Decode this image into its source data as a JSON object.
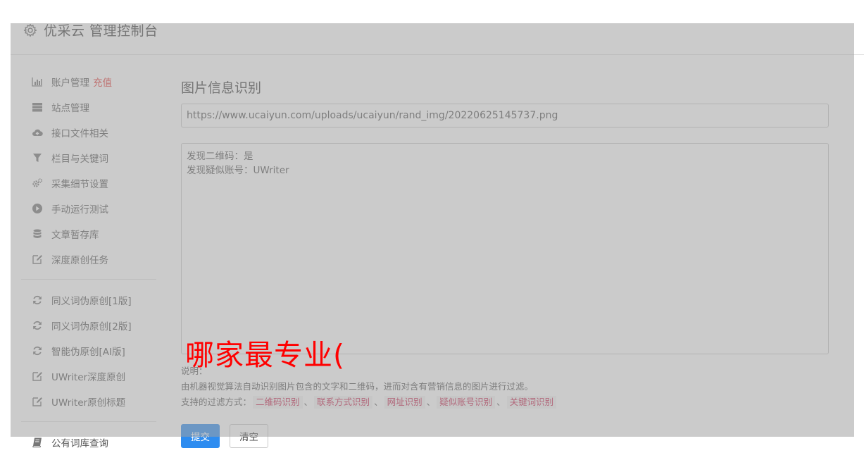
{
  "header": {
    "title": "优采云 管理控制台",
    "icon": "gear-icon"
  },
  "sidebar": {
    "group1": [
      {
        "label": "账户管理",
        "badge": "充值",
        "icon": "bar-chart-icon"
      },
      {
        "label": "站点管理",
        "icon": "server-icon"
      },
      {
        "label": "接口文件相关",
        "icon": "cloud-upload-icon"
      },
      {
        "label": "栏目与关键词",
        "icon": "filter-icon"
      },
      {
        "label": "采集细节设置",
        "icon": "cogs-icon"
      },
      {
        "label": "手动运行测试",
        "icon": "play-circle-icon"
      },
      {
        "label": "文章暂存库",
        "icon": "database-icon"
      },
      {
        "label": "深度原创任务",
        "icon": "edit-icon"
      }
    ],
    "group2": [
      {
        "label": "同义词伪原创[1版]",
        "icon": "refresh-icon"
      },
      {
        "label": "同义词伪原创[2版]",
        "icon": "refresh-icon"
      },
      {
        "label": "智能伪原创[AI版]",
        "icon": "refresh-icon"
      },
      {
        "label": "UWriter深度原创",
        "icon": "edit-icon"
      },
      {
        "label": "UWriter原创标题",
        "icon": "edit-icon"
      }
    ],
    "group3": [
      {
        "label": "公有词库查询",
        "icon": "book-icon"
      }
    ]
  },
  "main": {
    "title": "图片信息识别",
    "url_value": "https://www.ucaiyun.com/uploads/ucaiyun/rand_img/20220625145737.png",
    "result_lines": [
      "发现二维码：是",
      "发现疑似账号：UWriter"
    ],
    "notes": {
      "label": "说明：",
      "description": "由机器视觉算法自动识别图片包含的文字和二维码，进而对含有营销信息的图片进行过滤。",
      "methods_label": "支持的过滤方式：",
      "methods": [
        "二维码识别",
        "联系方式识别",
        "网址识别",
        "疑似账号识别",
        "关键词识别"
      ],
      "separator": "、"
    },
    "buttons": {
      "submit": "提交",
      "clear": "清空"
    }
  },
  "overlay_text": "哪家最专业(",
  "colors": {
    "primary": "#2d8cf0",
    "badge": "#e53935",
    "tag_text": "#c7254e",
    "overlay_text": "#ff0000"
  }
}
